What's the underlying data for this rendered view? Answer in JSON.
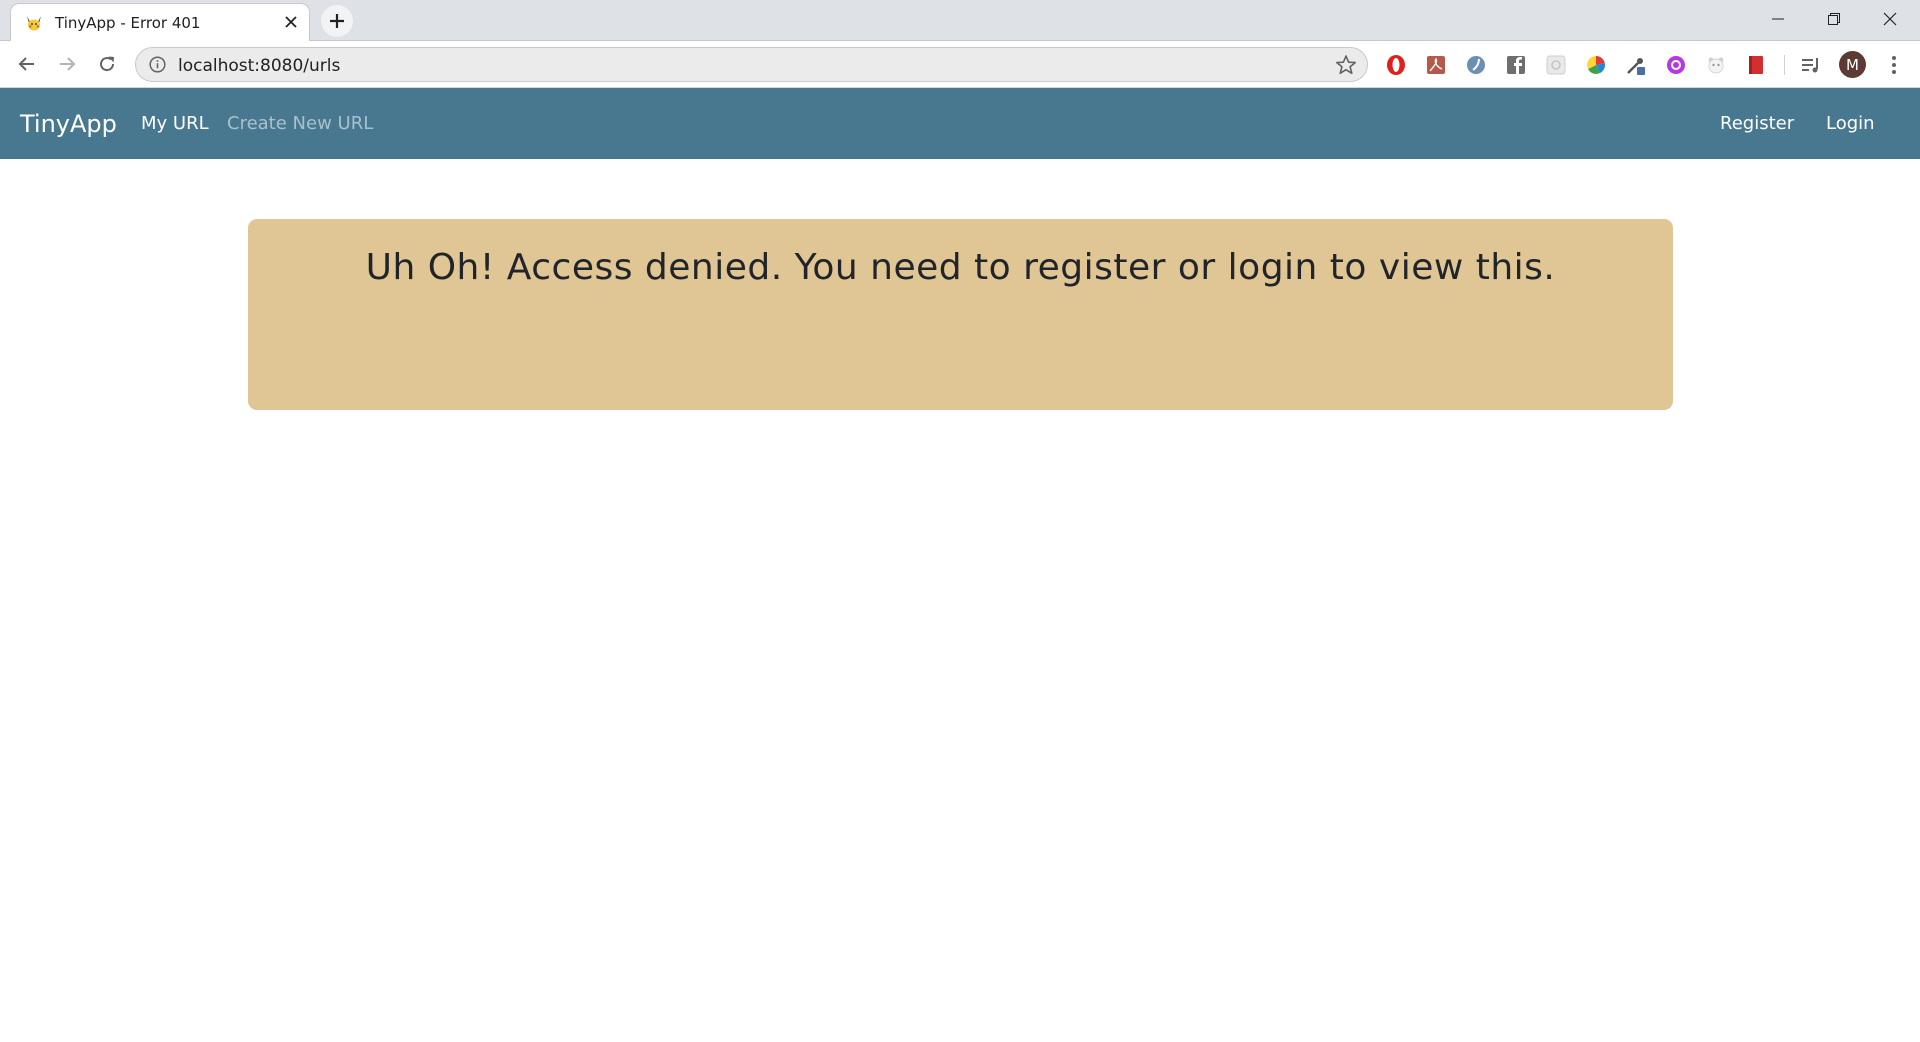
{
  "browser": {
    "tab": {
      "title": "TinyApp - Error 401",
      "favicon": "pikachu-icon"
    },
    "new_tab_icon": "plus-icon",
    "url": "localhost:8080/urls",
    "profile_initial": "M",
    "extensions": [
      "opera-icon",
      "pdf-icon",
      "dictionary-icon",
      "facebook-icon",
      "screenshot-icon",
      "color-picker-icon",
      "eyedropper-icon",
      "purple-extension-icon",
      "panda-icon",
      "bookmark-icon",
      "media-controls-icon"
    ]
  },
  "navbar": {
    "brand": "TinyApp",
    "links": {
      "my_url": "My URL",
      "create_new_url": "Create New URL",
      "register": "Register",
      "login": "Login"
    },
    "colors": {
      "background": "#48788f",
      "active": "#ffffff",
      "muted": "#a9c1cd"
    }
  },
  "alert": {
    "message": "Uh Oh! Access denied. You need to register or login to view this.",
    "background": "#e0c595"
  }
}
